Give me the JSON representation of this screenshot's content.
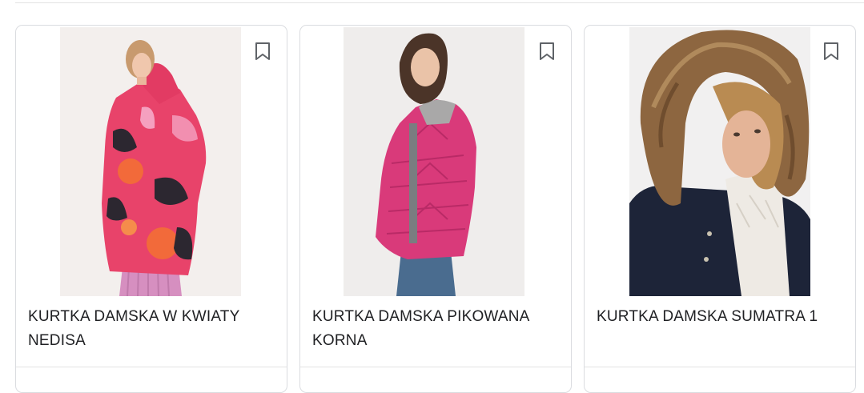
{
  "products": [
    {
      "name": "KURTKA DAMSKA W KWIATY NEDISA",
      "image_alt": "Woman wearing a pink jacket with large dark and orange flower print over a pink pleated skirt"
    },
    {
      "name": "KURTKA DAMSKA PIKOWANA KORNA",
      "image_alt": "Woman wearing a fuchsia quilted jacket with a grey hood and jeans"
    },
    {
      "name": "KURTKA DAMSKA SUMATRA 1",
      "image_alt": "Woman wearing a navy parka with a brown fur-trimmed hood and a white knit sweater"
    }
  ],
  "colors": {
    "card_border": "#dadce0",
    "title_text": "#202124",
    "bookmark_icon": "#5f6368"
  },
  "icons": {
    "save": "bookmark-icon"
  }
}
